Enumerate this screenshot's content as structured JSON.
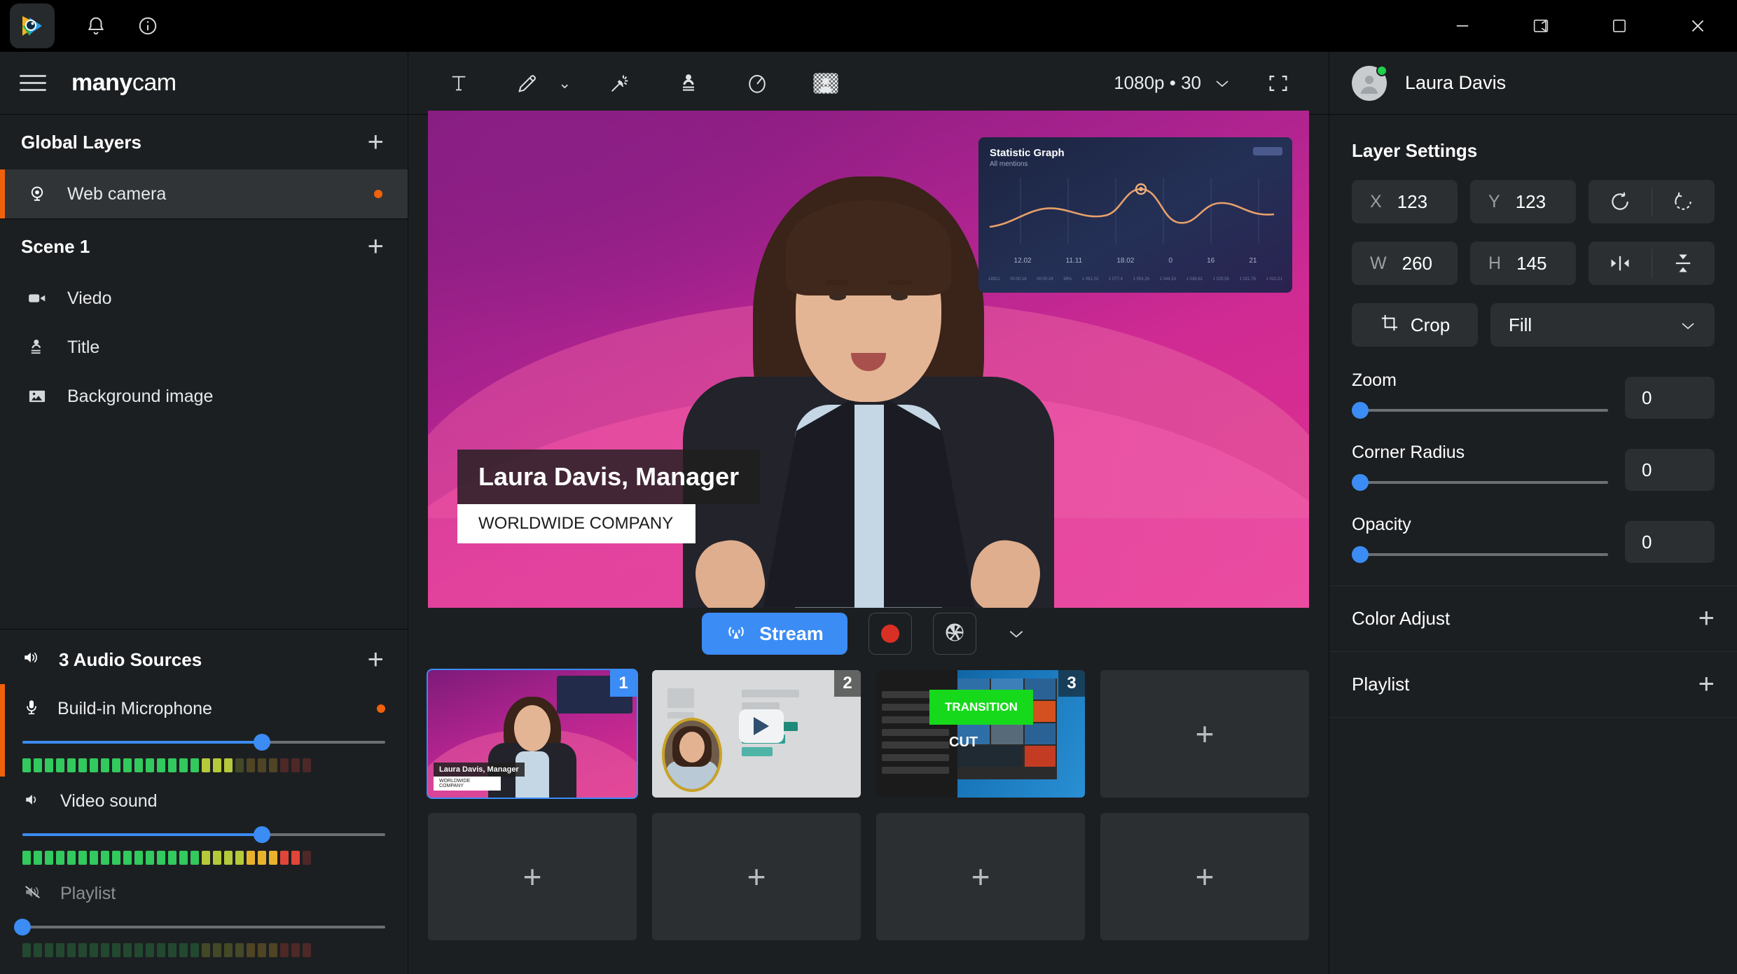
{
  "window": {
    "logo_icon": "manycam-logo-icon",
    "notifications_icon": "bell-icon",
    "info_icon": "info-circle-icon",
    "minimize_icon": "minimize-icon",
    "restore_icon": "restore-window-icon",
    "maximize_icon": "maximize-icon",
    "close_icon": "close-icon"
  },
  "brand": {
    "menu_icon": "hamburger-menu-icon",
    "name_bold": "many",
    "name_light": "cam"
  },
  "sidebar": {
    "global_layers": {
      "title": "Global Layers",
      "add_icon": "plus-icon",
      "items": [
        {
          "label": "Web camera",
          "icon": "webcam-icon",
          "active": true,
          "status_dot": true
        }
      ]
    },
    "scene": {
      "title": "Scene 1",
      "add_icon": "plus-icon",
      "items": [
        {
          "label": "Viedo",
          "icon": "video-camera-icon"
        },
        {
          "label": "Title",
          "icon": "lower-third-icon"
        },
        {
          "label": "Background image",
          "icon": "image-icon"
        }
      ]
    },
    "audio": {
      "title": "3 Audio Sources",
      "header_icon": "speaker-icon",
      "add_icon": "plus-icon",
      "sources": [
        {
          "label": "Build-in Microphone",
          "icon": "microphone-icon",
          "volume": 66,
          "muted": false,
          "active": true,
          "level": 72,
          "status_dot": true
        },
        {
          "label": "Video sound",
          "icon": "speaker-icon",
          "volume": 66,
          "muted": false,
          "active": false,
          "level": 96,
          "status_dot": false
        },
        {
          "label": "Playlist",
          "icon": "speaker-muted-icon",
          "volume": 0,
          "muted": true,
          "active": false,
          "level": 0,
          "status_dot": false
        }
      ]
    }
  },
  "toolbar": {
    "tools": [
      {
        "name": "text-tool",
        "icon": "text-icon"
      },
      {
        "name": "draw-tool",
        "icon": "pencil-icon",
        "has_chevron": true
      },
      {
        "name": "effects-tool",
        "icon": "magic-wand-icon"
      },
      {
        "name": "lower-third-tool",
        "icon": "lower-third-icon"
      },
      {
        "name": "timer-tool",
        "icon": "stopwatch-icon"
      },
      {
        "name": "chroma-key-tool",
        "icon": "chroma-key-icon"
      }
    ],
    "resolution": "1080p • 30",
    "resolution_chevron": "chevron-down-icon",
    "fullscreen_icon": "fullscreen-icon"
  },
  "preview": {
    "lower_third": {
      "name": "Laura Davis, Manager",
      "company": "WORLDWIDE COMPANY"
    },
    "overlay_chart": {
      "title": "Statistic Graph",
      "subtitle": "All mentions",
      "x_labels": [
        "12.02",
        "11.11",
        "18.02",
        "0",
        "16",
        "21"
      ],
      "footer_left": "18921",
      "footer_items": [
        "00:00:18",
        "00:00:24",
        "98%",
        "1 081,02",
        "1 077,4",
        "1 054,26",
        "1 044,33",
        "1 038,62",
        "1 029,55",
        "1 021,78",
        "1 010,21"
      ]
    }
  },
  "stream_bar": {
    "stream_label": "Stream",
    "stream_icon": "broadcast-icon",
    "record_icon": "record-dot-icon",
    "snapshot_icon": "aperture-icon",
    "more_icon": "chevron-down-icon"
  },
  "presets": {
    "add_icon": "plus-icon",
    "row1": [
      {
        "number": "1",
        "type": "scene-presenter",
        "selected": true,
        "caption_name": "Laura Davis, Manager",
        "caption_company": "WORLDWIDE COMPANY"
      },
      {
        "number": "2",
        "type": "scene-video-chart",
        "selected": false
      },
      {
        "number": "3",
        "type": "scene-desktop",
        "selected": false,
        "transition_label": "TRANSITION",
        "cut_label": "CUT"
      },
      {
        "number": "",
        "type": "empty",
        "selected": false
      }
    ],
    "row2": [
      {
        "number": "",
        "type": "empty"
      },
      {
        "number": "",
        "type": "empty"
      },
      {
        "number": "",
        "type": "empty"
      },
      {
        "number": "",
        "type": "empty"
      }
    ]
  },
  "right_panel": {
    "user": {
      "name": "Laura Davis",
      "avatar_icon": "avatar-icon",
      "online": true
    },
    "layer_settings": {
      "title": "Layer Settings",
      "x": {
        "key": "X",
        "value": "123"
      },
      "y": {
        "key": "Y",
        "value": "123"
      },
      "w": {
        "key": "W",
        "value": "260"
      },
      "h": {
        "key": "H",
        "value": "145"
      },
      "rotate_left_icon": "rotate-left-icon",
      "rotate_right_icon": "rotate-right-icon",
      "flip_horizontal_icon": "flip-horizontal-icon",
      "flip_vertical_icon": "flip-vertical-icon",
      "crop_label": "Crop",
      "crop_icon": "crop-icon",
      "fit_mode": "Fill",
      "fit_chevron": "chevron-down-icon",
      "sliders": [
        {
          "label": "Zoom",
          "value": "0",
          "percent": 0
        },
        {
          "label": "Corner Radius",
          "value": "0",
          "percent": 0
        },
        {
          "label": "Opacity",
          "value": "0",
          "percent": 0
        }
      ]
    },
    "sections": [
      {
        "label": "Color Adjust",
        "add_icon": "plus-icon"
      },
      {
        "label": "Playlist",
        "add_icon": "plus-icon"
      }
    ]
  },
  "colors": {
    "accent_orange": "#f1610b",
    "accent_blue": "#3b8cf5",
    "record_red": "#d93025",
    "online_green": "#1fd14a",
    "transition_green": "#16d91c",
    "panel_bg": "#1c1f21",
    "field_bg": "#2b2f32"
  }
}
